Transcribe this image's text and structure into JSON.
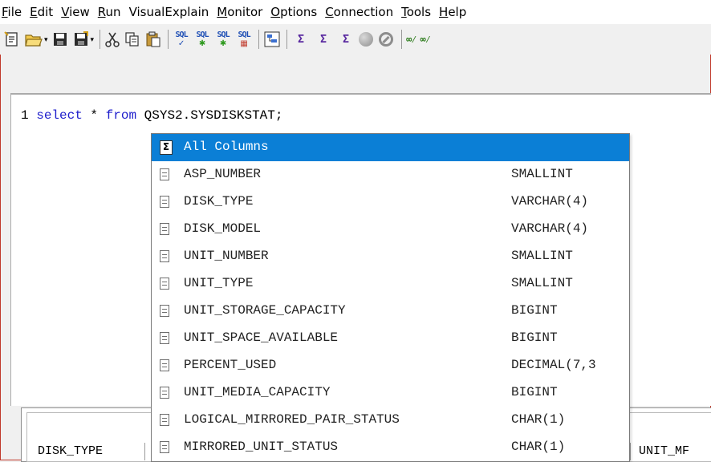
{
  "menu": [
    {
      "label": "File",
      "u": "F",
      "rest": "ile"
    },
    {
      "label": "Edit",
      "u": "E",
      "rest": "dit"
    },
    {
      "label": "View",
      "u": "V",
      "rest": "iew"
    },
    {
      "label": "Run",
      "u": "R",
      "rest": "un"
    },
    {
      "label": "VisualExplain",
      "u": "",
      "rest": "VisualExplain"
    },
    {
      "label": "Monitor",
      "u": "M",
      "rest": "onitor"
    },
    {
      "label": "Options",
      "u": "O",
      "rest": "ptions"
    },
    {
      "label": "Connection",
      "u": "C",
      "rest": "onnection"
    },
    {
      "label": "Tools",
      "u": "T",
      "rest": "ools"
    },
    {
      "label": "Help",
      "u": "H",
      "rest": "elp"
    }
  ],
  "toolbar": {
    "sql_labels": [
      "SQL",
      "SQL",
      "SQL",
      "SQL"
    ],
    "stat_labels": [
      "Σ",
      "Σ",
      "Σ"
    ],
    "icons": [
      "new-icon",
      "open-icon",
      "save-icon",
      "save-as-icon",
      "cut-icon",
      "copy-icon",
      "paste-icon",
      "run-sql-icon",
      "run-all-icon",
      "run-from-cursor-icon",
      "run-to-table-icon",
      "visual-explain-icon",
      "statistics-icon",
      "statistics-2-icon",
      "statistics-3-icon",
      "stop-icon",
      "cancel-icon",
      "link-icon",
      "link-2-icon"
    ]
  },
  "editor": {
    "line_number": "1",
    "tokens": {
      "kw1": "select",
      "star": " * ",
      "kw2": "from",
      "rest": " QSYS2.SYSDISKSTAT;"
    }
  },
  "autocomplete": {
    "all_columns_icon": "Σ",
    "all_columns": "All Columns",
    "items": [
      {
        "name": "ASP_NUMBER",
        "type": "SMALLINT"
      },
      {
        "name": "DISK_TYPE",
        "type": "VARCHAR(4)"
      },
      {
        "name": "DISK_MODEL",
        "type": "VARCHAR(4)"
      },
      {
        "name": "UNIT_NUMBER",
        "type": "SMALLINT"
      },
      {
        "name": "UNIT_TYPE",
        "type": "SMALLINT"
      },
      {
        "name": "UNIT_STORAGE_CAPACITY",
        "type": "BIGINT"
      },
      {
        "name": "UNIT_SPACE_AVAILABLE",
        "type": "BIGINT"
      },
      {
        "name": "PERCENT_USED",
        "type": "DECIMAL(7,3"
      },
      {
        "name": "UNIT_MEDIA_CAPACITY",
        "type": "BIGINT"
      },
      {
        "name": "LOGICAL_MIRRORED_PAIR_STATUS",
        "type": "CHAR(1)"
      },
      {
        "name": "MIRRORED_UNIT_STATUS",
        "type": "CHAR(1)"
      }
    ]
  },
  "results": {
    "columns": [
      "DISK_TYPE",
      "UNIT_MF"
    ]
  },
  "colors": {
    "selection": "#0b7fd6",
    "keyword": "#1f1fcc",
    "frame_border": "#c0392b"
  }
}
